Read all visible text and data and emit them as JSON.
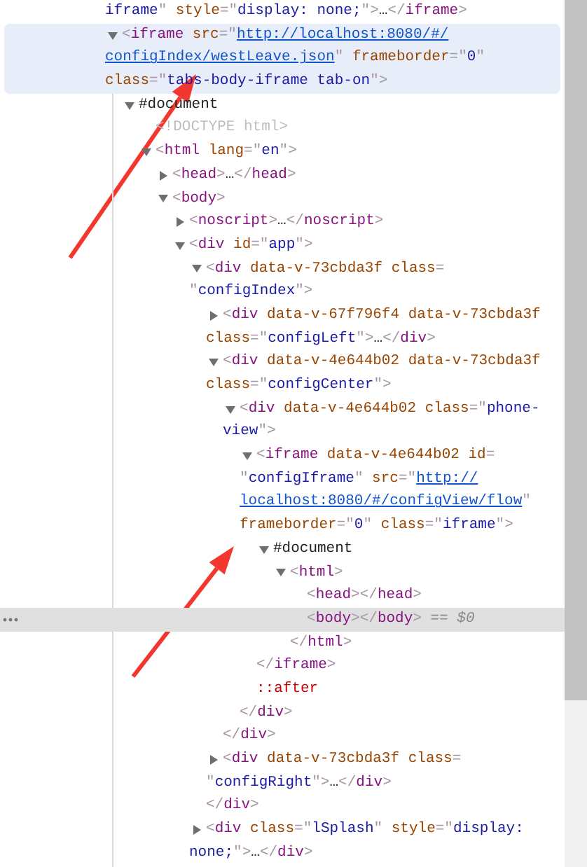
{
  "dom_tree": [
    {
      "continued": true,
      "selected": false,
      "hovered": false,
      "lines": [
        [
          {
            "kind": "v",
            "text": "iframe"
          },
          {
            "kind": "p",
            "text": "\""
          },
          {
            "kind": "a",
            "text": " style"
          },
          {
            "kind": "p",
            "text": "=\""
          },
          {
            "kind": "v",
            "text": "display: none;"
          },
          {
            "kind": "p",
            "text": "\">"
          },
          {
            "kind": "x",
            "text": "…"
          },
          {
            "kind": "p",
            "text": "</"
          },
          {
            "kind": "t",
            "text": "iframe"
          },
          {
            "kind": "p",
            "text": ">"
          }
        ]
      ]
    },
    {
      "expanded": true,
      "selected": false,
      "hovered": true,
      "lines": [
        [
          {
            "kind": "p",
            "text": "<"
          },
          {
            "kind": "t",
            "text": "iframe"
          },
          {
            "kind": "a",
            "text": " src"
          },
          {
            "kind": "p",
            "text": "=\""
          },
          {
            "kind": "l",
            "text": "http://localhost:8080/#/"
          }
        ],
        [
          {
            "kind": "l",
            "text": "configIndex/westLeave.json"
          },
          {
            "kind": "p",
            "text": "\""
          },
          {
            "kind": "a",
            "text": " frameborder"
          },
          {
            "kind": "p",
            "text": "=\""
          },
          {
            "kind": "v",
            "text": "0"
          },
          {
            "kind": "p",
            "text": "\""
          }
        ],
        [
          {
            "kind": "a",
            "text": "class"
          },
          {
            "kind": "p",
            "text": "=\""
          },
          {
            "kind": "v",
            "text": "tabs-body-iframe tab-on"
          },
          {
            "kind": "p",
            "text": "\">"
          }
        ]
      ],
      "children": [
        {
          "expanded": true,
          "selected": false,
          "hovered": false,
          "lines": [
            [
              {
                "kind": "x",
                "text": "#document"
              }
            ]
          ],
          "children": [
            {
              "selected": false,
              "hovered": false,
              "lines": [
                [
                  {
                    "kind": "d",
                    "text": "<!DOCTYPE html>"
                  }
                ]
              ]
            },
            {
              "expanded": true,
              "selected": false,
              "hovered": false,
              "lines": [
                [
                  {
                    "kind": "p",
                    "text": "<"
                  },
                  {
                    "kind": "t",
                    "text": "html"
                  },
                  {
                    "kind": "a",
                    "text": " lang"
                  },
                  {
                    "kind": "p",
                    "text": "=\""
                  },
                  {
                    "kind": "v",
                    "text": "en"
                  },
                  {
                    "kind": "p",
                    "text": "\">"
                  }
                ]
              ],
              "children": [
                {
                  "expanded": false,
                  "selected": false,
                  "hovered": false,
                  "lines": [
                    [
                      {
                        "kind": "p",
                        "text": "<"
                      },
                      {
                        "kind": "t",
                        "text": "head"
                      },
                      {
                        "kind": "p",
                        "text": ">"
                      },
                      {
                        "kind": "x",
                        "text": "…"
                      },
                      {
                        "kind": "p",
                        "text": "</"
                      },
                      {
                        "kind": "t",
                        "text": "head"
                      },
                      {
                        "kind": "p",
                        "text": ">"
                      }
                    ]
                  ]
                },
                {
                  "expanded": true,
                  "selected": false,
                  "hovered": false,
                  "lines": [
                    [
                      {
                        "kind": "p",
                        "text": "<"
                      },
                      {
                        "kind": "t",
                        "text": "body"
                      },
                      {
                        "kind": "p",
                        "text": ">"
                      }
                    ]
                  ],
                  "children": [
                    {
                      "expanded": false,
                      "selected": false,
                      "hovered": false,
                      "lines": [
                        [
                          {
                            "kind": "p",
                            "text": "<"
                          },
                          {
                            "kind": "t",
                            "text": "noscript"
                          },
                          {
                            "kind": "p",
                            "text": ">"
                          },
                          {
                            "kind": "x",
                            "text": "…"
                          },
                          {
                            "kind": "p",
                            "text": "</"
                          },
                          {
                            "kind": "t",
                            "text": "noscript"
                          },
                          {
                            "kind": "p",
                            "text": ">"
                          }
                        ]
                      ]
                    },
                    {
                      "expanded": true,
                      "selected": false,
                      "hovered": false,
                      "lines": [
                        [
                          {
                            "kind": "p",
                            "text": "<"
                          },
                          {
                            "kind": "t",
                            "text": "div"
                          },
                          {
                            "kind": "a",
                            "text": " id"
                          },
                          {
                            "kind": "p",
                            "text": "=\""
                          },
                          {
                            "kind": "v",
                            "text": "app"
                          },
                          {
                            "kind": "p",
                            "text": "\">"
                          }
                        ]
                      ],
                      "children": [
                        {
                          "expanded": true,
                          "selected": false,
                          "hovered": false,
                          "lines": [
                            [
                              {
                                "kind": "p",
                                "text": "<"
                              },
                              {
                                "kind": "t",
                                "text": "div"
                              },
                              {
                                "kind": "a",
                                "text": " data-v-73cbda3f class"
                              },
                              {
                                "kind": "p",
                                "text": "="
                              }
                            ],
                            [
                              {
                                "kind": "p",
                                "text": "\""
                              },
                              {
                                "kind": "v",
                                "text": "configIndex"
                              },
                              {
                                "kind": "p",
                                "text": "\">"
                              }
                            ]
                          ],
                          "children": [
                            {
                              "expanded": false,
                              "selected": false,
                              "hovered": false,
                              "lines": [
                                [
                                  {
                                    "kind": "p",
                                    "text": "<"
                                  },
                                  {
                                    "kind": "t",
                                    "text": "div"
                                  },
                                  {
                                    "kind": "a",
                                    "text": " data-v-67f796f4 data-v-73cbda3f"
                                  }
                                ],
                                [
                                  {
                                    "kind": "a",
                                    "text": "class"
                                  },
                                  {
                                    "kind": "p",
                                    "text": "=\""
                                  },
                                  {
                                    "kind": "v",
                                    "text": "configLeft"
                                  },
                                  {
                                    "kind": "p",
                                    "text": "\">"
                                  },
                                  {
                                    "kind": "x",
                                    "text": "…"
                                  },
                                  {
                                    "kind": "p",
                                    "text": "</"
                                  },
                                  {
                                    "kind": "t",
                                    "text": "div"
                                  },
                                  {
                                    "kind": "p",
                                    "text": ">"
                                  }
                                ]
                              ]
                            },
                            {
                              "expanded": true,
                              "selected": false,
                              "hovered": false,
                              "lines": [
                                [
                                  {
                                    "kind": "p",
                                    "text": "<"
                                  },
                                  {
                                    "kind": "t",
                                    "text": "div"
                                  },
                                  {
                                    "kind": "a",
                                    "text": " data-v-4e644b02 data-v-73cbda3f"
                                  }
                                ],
                                [
                                  {
                                    "kind": "a",
                                    "text": "class"
                                  },
                                  {
                                    "kind": "p",
                                    "text": "=\""
                                  },
                                  {
                                    "kind": "v",
                                    "text": "configCenter"
                                  },
                                  {
                                    "kind": "p",
                                    "text": "\">"
                                  }
                                ]
                              ],
                              "children": [
                                {
                                  "expanded": true,
                                  "selected": false,
                                  "hovered": false,
                                  "lines": [
                                    [
                                      {
                                        "kind": "p",
                                        "text": "<"
                                      },
                                      {
                                        "kind": "t",
                                        "text": "div"
                                      },
                                      {
                                        "kind": "a",
                                        "text": " data-v-4e644b02 class"
                                      },
                                      {
                                        "kind": "p",
                                        "text": "=\""
                                      },
                                      {
                                        "kind": "v",
                                        "text": "phone-"
                                      }
                                    ],
                                    [
                                      {
                                        "kind": "v",
                                        "text": "view"
                                      },
                                      {
                                        "kind": "p",
                                        "text": "\">"
                                      }
                                    ]
                                  ],
                                  "children": [
                                    {
                                      "expanded": true,
                                      "selected": false,
                                      "hovered": false,
                                      "lines": [
                                        [
                                          {
                                            "kind": "p",
                                            "text": "<"
                                          },
                                          {
                                            "kind": "t",
                                            "text": "iframe"
                                          },
                                          {
                                            "kind": "a",
                                            "text": " data-v-4e644b02 id"
                                          },
                                          {
                                            "kind": "p",
                                            "text": "="
                                          }
                                        ],
                                        [
                                          {
                                            "kind": "p",
                                            "text": "\""
                                          },
                                          {
                                            "kind": "v",
                                            "text": "configIframe"
                                          },
                                          {
                                            "kind": "p",
                                            "text": "\""
                                          },
                                          {
                                            "kind": "a",
                                            "text": " src"
                                          },
                                          {
                                            "kind": "p",
                                            "text": "=\""
                                          },
                                          {
                                            "kind": "l",
                                            "text": "http://"
                                          }
                                        ],
                                        [
                                          {
                                            "kind": "l",
                                            "text": "localhost:8080/#/configView/flow"
                                          },
                                          {
                                            "kind": "p",
                                            "text": "\""
                                          }
                                        ],
                                        [
                                          {
                                            "kind": "a",
                                            "text": "frameborder"
                                          },
                                          {
                                            "kind": "p",
                                            "text": "=\""
                                          },
                                          {
                                            "kind": "v",
                                            "text": "0"
                                          },
                                          {
                                            "kind": "p",
                                            "text": "\""
                                          },
                                          {
                                            "kind": "a",
                                            "text": " class"
                                          },
                                          {
                                            "kind": "p",
                                            "text": "=\""
                                          },
                                          {
                                            "kind": "v",
                                            "text": "iframe"
                                          },
                                          {
                                            "kind": "p",
                                            "text": "\">"
                                          }
                                        ]
                                      ],
                                      "children": [
                                        {
                                          "expanded": true,
                                          "selected": false,
                                          "hovered": false,
                                          "lines": [
                                            [
                                              {
                                                "kind": "x",
                                                "text": "#document"
                                              }
                                            ]
                                          ],
                                          "children": [
                                            {
                                              "expanded": true,
                                              "selected": false,
                                              "hovered": false,
                                              "lines": [
                                                [
                                                  {
                                                    "kind": "p",
                                                    "text": "<"
                                                  },
                                                  {
                                                    "kind": "t",
                                                    "text": "html"
                                                  },
                                                  {
                                                    "kind": "p",
                                                    "text": ">"
                                                  }
                                                ]
                                              ],
                                              "children": [
                                                {
                                                  "selected": false,
                                                  "hovered": false,
                                                  "lines": [
                                                    [
                                                      {
                                                        "kind": "p",
                                                        "text": "<"
                                                      },
                                                      {
                                                        "kind": "t",
                                                        "text": "head"
                                                      },
                                                      {
                                                        "kind": "p",
                                                        "text": "></"
                                                      },
                                                      {
                                                        "kind": "t",
                                                        "text": "head"
                                                      },
                                                      {
                                                        "kind": "p",
                                                        "text": ">"
                                                      }
                                                    ]
                                                  ]
                                                },
                                                {
                                                  "selected": true,
                                                  "hovered": false,
                                                  "lines": [
                                                    [
                                                      {
                                                        "kind": "p",
                                                        "text": "<"
                                                      },
                                                      {
                                                        "kind": "t",
                                                        "text": "body"
                                                      },
                                                      {
                                                        "kind": "p",
                                                        "text": "></"
                                                      },
                                                      {
                                                        "kind": "t",
                                                        "text": "body"
                                                      },
                                                      {
                                                        "kind": "p",
                                                        "text": ">"
                                                      },
                                                      {
                                                        "kind": "e",
                                                        "text": " == $0"
                                                      }
                                                    ]
                                                  ]
                                                }
                                              ],
                                              "close": [
                                                {
                                                  "kind": "p",
                                                  "text": "</"
                                                },
                                                {
                                                  "kind": "t",
                                                  "text": "html"
                                                },
                                                {
                                                  "kind": "p",
                                                  "text": ">"
                                                }
                                              ]
                                            }
                                          ]
                                        }
                                      ],
                                      "close": [
                                        {
                                          "kind": "p",
                                          "text": "</"
                                        },
                                        {
                                          "kind": "t",
                                          "text": "iframe"
                                        },
                                        {
                                          "kind": "p",
                                          "text": ">"
                                        }
                                      ]
                                    },
                                    {
                                      "selected": false,
                                      "hovered": false,
                                      "lines": [
                                        [
                                          {
                                            "kind": "s",
                                            "text": "::after"
                                          }
                                        ]
                                      ]
                                    }
                                  ],
                                  "close": [
                                    {
                                      "kind": "p",
                                      "text": "</"
                                    },
                                    {
                                      "kind": "t",
                                      "text": "div"
                                    },
                                    {
                                      "kind": "p",
                                      "text": ">"
                                    }
                                  ]
                                }
                              ],
                              "close": [
                                {
                                  "kind": "p",
                                  "text": "</"
                                },
                                {
                                  "kind": "t",
                                  "text": "div"
                                },
                                {
                                  "kind": "p",
                                  "text": ">"
                                }
                              ]
                            },
                            {
                              "expanded": false,
                              "selected": false,
                              "hovered": false,
                              "lines": [
                                [
                                  {
                                    "kind": "p",
                                    "text": "<"
                                  },
                                  {
                                    "kind": "t",
                                    "text": "div"
                                  },
                                  {
                                    "kind": "a",
                                    "text": " data-v-73cbda3f class"
                                  },
                                  {
                                    "kind": "p",
                                    "text": "="
                                  }
                                ],
                                [
                                  {
                                    "kind": "p",
                                    "text": "\""
                                  },
                                  {
                                    "kind": "v",
                                    "text": "configRight"
                                  },
                                  {
                                    "kind": "p",
                                    "text": "\">"
                                  },
                                  {
                                    "kind": "x",
                                    "text": "…"
                                  },
                                  {
                                    "kind": "p",
                                    "text": "</"
                                  },
                                  {
                                    "kind": "t",
                                    "text": "div"
                                  },
                                  {
                                    "kind": "p",
                                    "text": ">"
                                  }
                                ]
                              ]
                            }
                          ],
                          "close": [
                            {
                              "kind": "p",
                              "text": "</"
                            },
                            {
                              "kind": "t",
                              "text": "div"
                            },
                            {
                              "kind": "p",
                              "text": ">"
                            }
                          ]
                        },
                        {
                          "expanded": false,
                          "selected": false,
                          "hovered": false,
                          "lines": [
                            [
                              {
                                "kind": "p",
                                "text": "<"
                              },
                              {
                                "kind": "t",
                                "text": "div"
                              },
                              {
                                "kind": "a",
                                "text": " class"
                              },
                              {
                                "kind": "p",
                                "text": "=\""
                              },
                              {
                                "kind": "v",
                                "text": "lSplash"
                              },
                              {
                                "kind": "p",
                                "text": "\""
                              },
                              {
                                "kind": "a",
                                "text": " style"
                              },
                              {
                                "kind": "p",
                                "text": "=\""
                              },
                              {
                                "kind": "v",
                                "text": "display:"
                              }
                            ],
                            [
                              {
                                "kind": "v",
                                "text": "none;"
                              },
                              {
                                "kind": "p",
                                "text": "\">"
                              },
                              {
                                "kind": "x",
                                "text": "…"
                              },
                              {
                                "kind": "p",
                                "text": "</"
                              },
                              {
                                "kind": "t",
                                "text": "div"
                              },
                              {
                                "kind": "p",
                                "text": ">"
                              }
                            ]
                          ]
                        }
                      ]
                    }
                  ]
                }
              ]
            }
          ]
        }
      ]
    }
  ]
}
